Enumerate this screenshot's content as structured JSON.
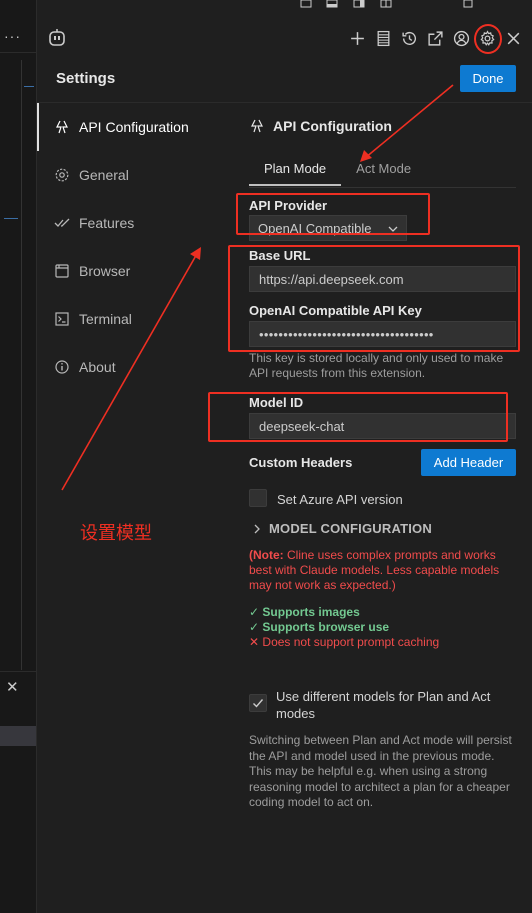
{
  "header": {
    "icons": [
      "robot-icon",
      "plus-icon",
      "server-icon",
      "history-icon",
      "popout-icon",
      "account-icon",
      "gear-icon",
      "close-icon"
    ]
  },
  "settings": {
    "title": "Settings",
    "done_label": "Done"
  },
  "sidebar": {
    "items": [
      {
        "label": "API Configuration",
        "icon": "api-icon",
        "active": true
      },
      {
        "label": "General",
        "icon": "gear-icon"
      },
      {
        "label": "Features",
        "icon": "check-icon"
      },
      {
        "label": "Browser",
        "icon": "browser-icon"
      },
      {
        "label": "Terminal",
        "icon": "terminal-icon"
      },
      {
        "label": "About",
        "icon": "info-icon"
      }
    ]
  },
  "content": {
    "section_title": "API Configuration",
    "mode_tabs": [
      "Plan Mode",
      "Act Mode"
    ],
    "active_mode": "Plan Mode",
    "api_provider_label": "API Provider",
    "api_provider_value": "OpenAI Compatible",
    "base_url_label": "Base URL",
    "base_url_value": "https://api.deepseek.com",
    "api_key_label": "OpenAI Compatible API Key",
    "api_key_value": "••••••••••••••••••••••••••••••••••••",
    "api_key_help": "This key is stored locally and only used to make API requests from this extension.",
    "model_id_label": "Model ID",
    "model_id_value": "deepseek-chat",
    "custom_headers_label": "Custom Headers",
    "add_header_label": "Add Header",
    "azure_label": "Set Azure API version",
    "model_config_label": "MODEL CONFIGURATION",
    "note_bold": "(Note:",
    "note_text": " Cline uses complex prompts and works best with Claude models. Less capable models may not work as expected.)",
    "features": [
      {
        "mark": "✓",
        "text": "Supports images",
        "ok": true
      },
      {
        "mark": "✓",
        "text": "Supports browser use",
        "ok": true
      },
      {
        "mark": "✕",
        "text": "Does not support prompt caching",
        "ok": false
      }
    ],
    "use_diff_models_label": "Use different models for Plan and Act modes",
    "use_diff_models_checked": true,
    "use_diff_models_desc": "Switching between Plan and Act mode will persist the API and model used in the previous mode. This may be helpful e.g. when using a strong reasoning model to architect a plan for a cheaper coding model to act on."
  },
  "annotation": {
    "text": "设置模型",
    "color": "#ee2f22"
  },
  "colors": {
    "accent": "#0e7ad1",
    "background": "#1f1f1f",
    "success": "#73c991",
    "error": "#f14c4c"
  }
}
